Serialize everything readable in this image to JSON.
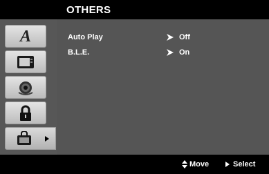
{
  "header": {
    "title": "OTHERS"
  },
  "tabs": [
    {
      "icon": "language-letter-a-icon",
      "letter": "A"
    },
    {
      "icon": "display-screen-icon"
    },
    {
      "icon": "speaker-audio-icon"
    },
    {
      "icon": "padlock-icon"
    },
    {
      "icon": "others-tools-icon",
      "active": true
    }
  ],
  "settings": [
    {
      "label": "Auto Play",
      "value": "Off"
    },
    {
      "label": "B.L.E.",
      "value": "On"
    }
  ],
  "footer": {
    "move_label": "Move",
    "select_label": "Select"
  }
}
